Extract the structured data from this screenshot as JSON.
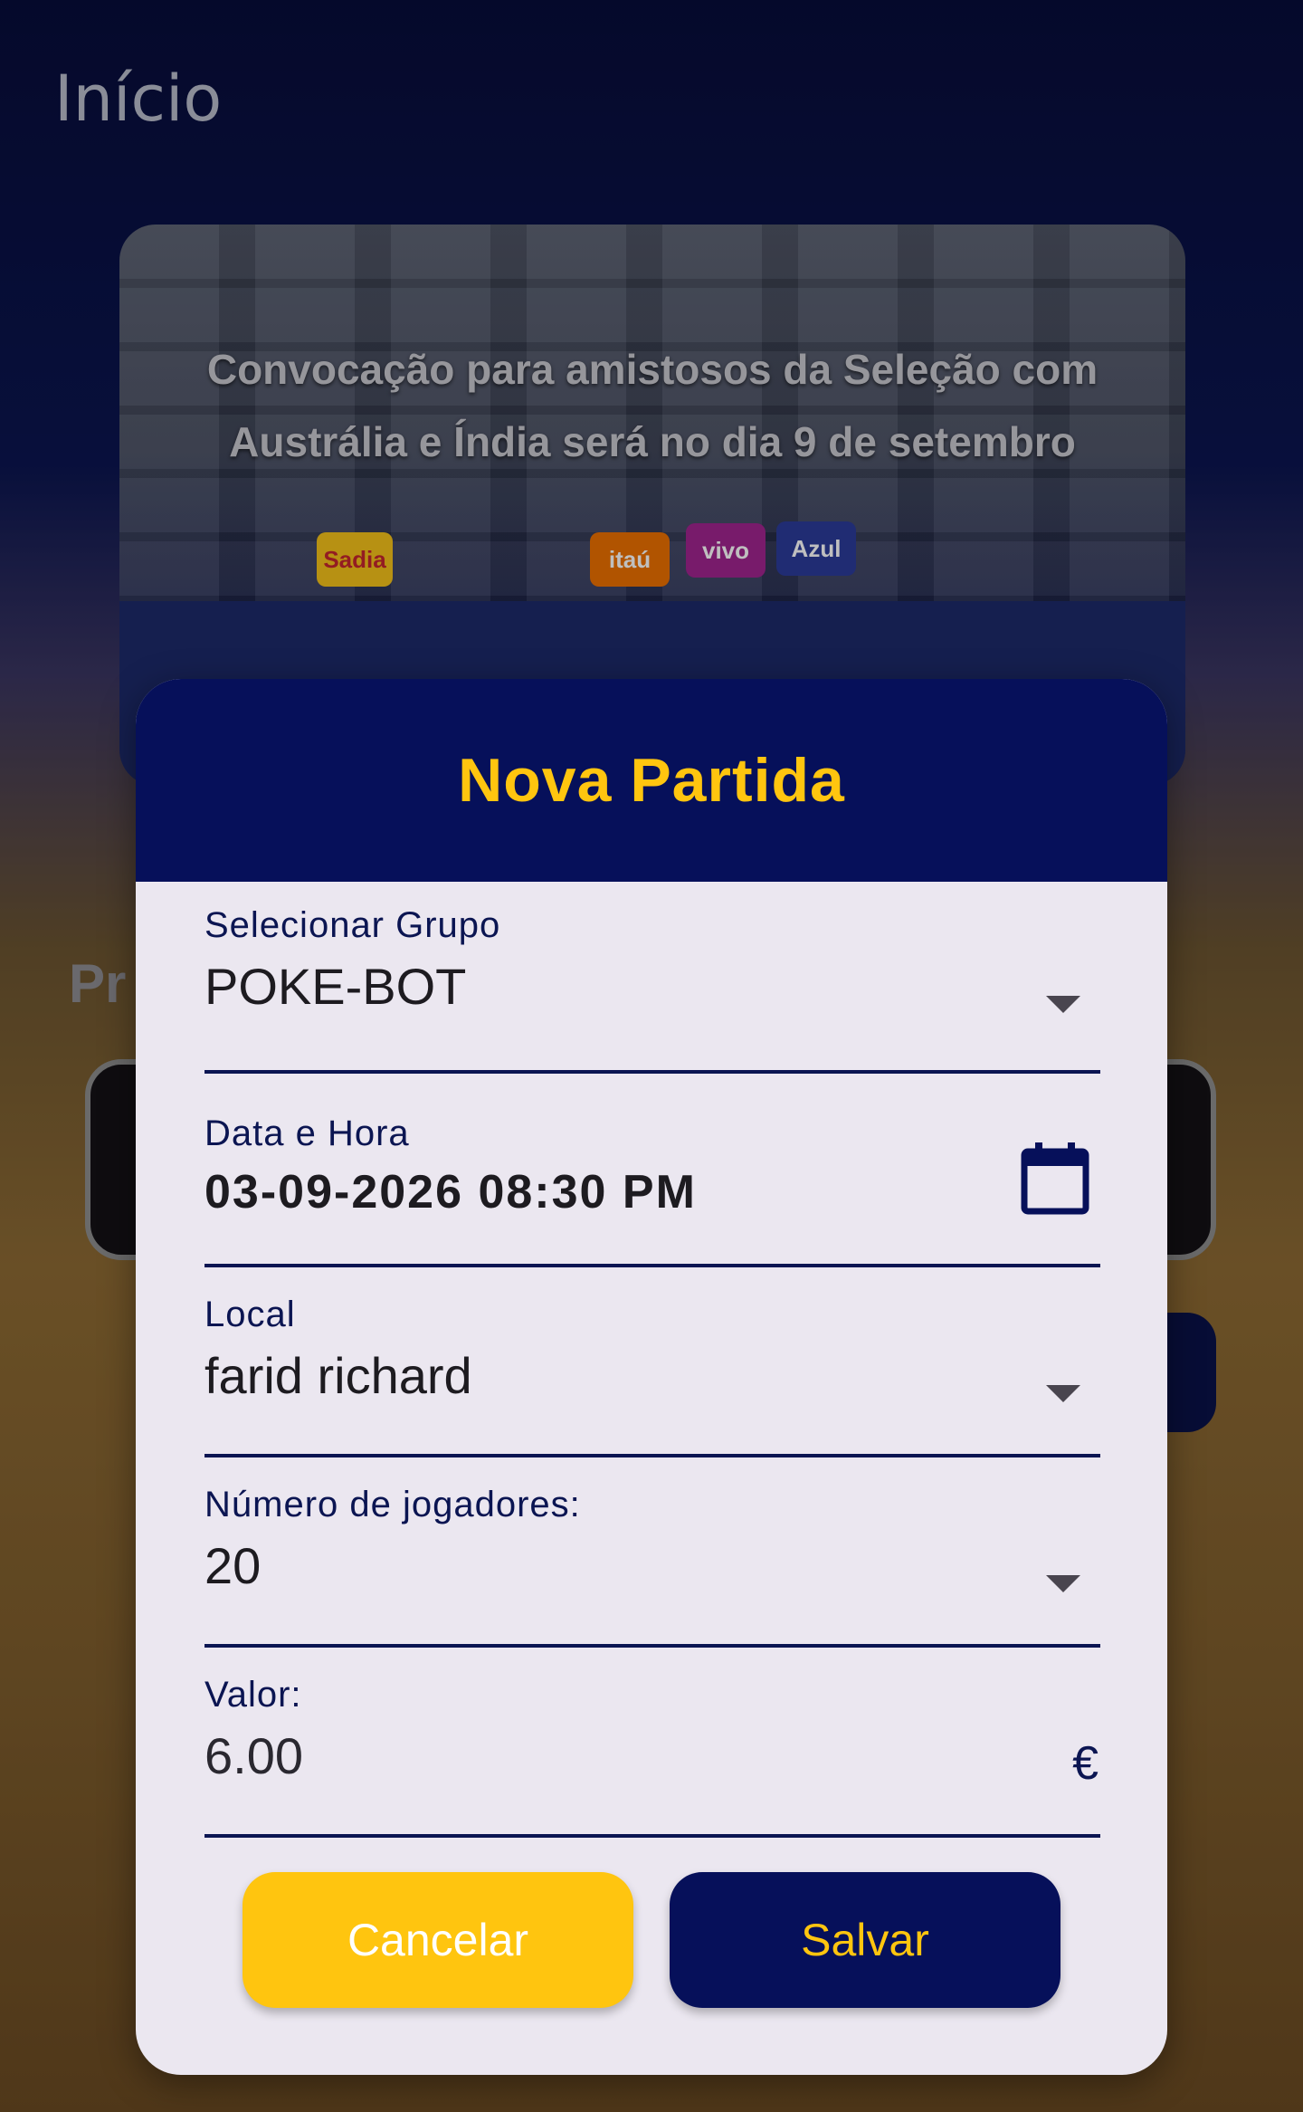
{
  "app_title": "Início",
  "news": {
    "headline": "Convocação para amistosos da Seleção com Austrália e Índia será no dia 9 de setembro",
    "sponsor_logos": [
      "Sadia",
      "itaú",
      "vivo",
      "Azul"
    ]
  },
  "background_section_label": "Pr",
  "dialog": {
    "title": "Nova Partida",
    "group": {
      "label": "Selecionar Grupo",
      "value": "POKE-BOT",
      "icon": "chevron-down-icon"
    },
    "datetime": {
      "label": "Data e Hora",
      "value": "03-09-2026 08:30 PM",
      "icon": "calendar-icon"
    },
    "location": {
      "label": "Local",
      "value": "farid richard",
      "icon": "chevron-down-icon"
    },
    "players": {
      "label": "Número de jogadores:",
      "value": "20",
      "icon": "chevron-down-icon"
    },
    "price": {
      "label": "Valor:",
      "value": "6.00",
      "currency_symbol": "€"
    },
    "cancel_label": "Cancelar",
    "save_label": "Salvar"
  },
  "colors": {
    "primary_navy": "#06105a",
    "accent_yellow": "#ffc50f",
    "dialog_bg": "#ebe7f0"
  }
}
